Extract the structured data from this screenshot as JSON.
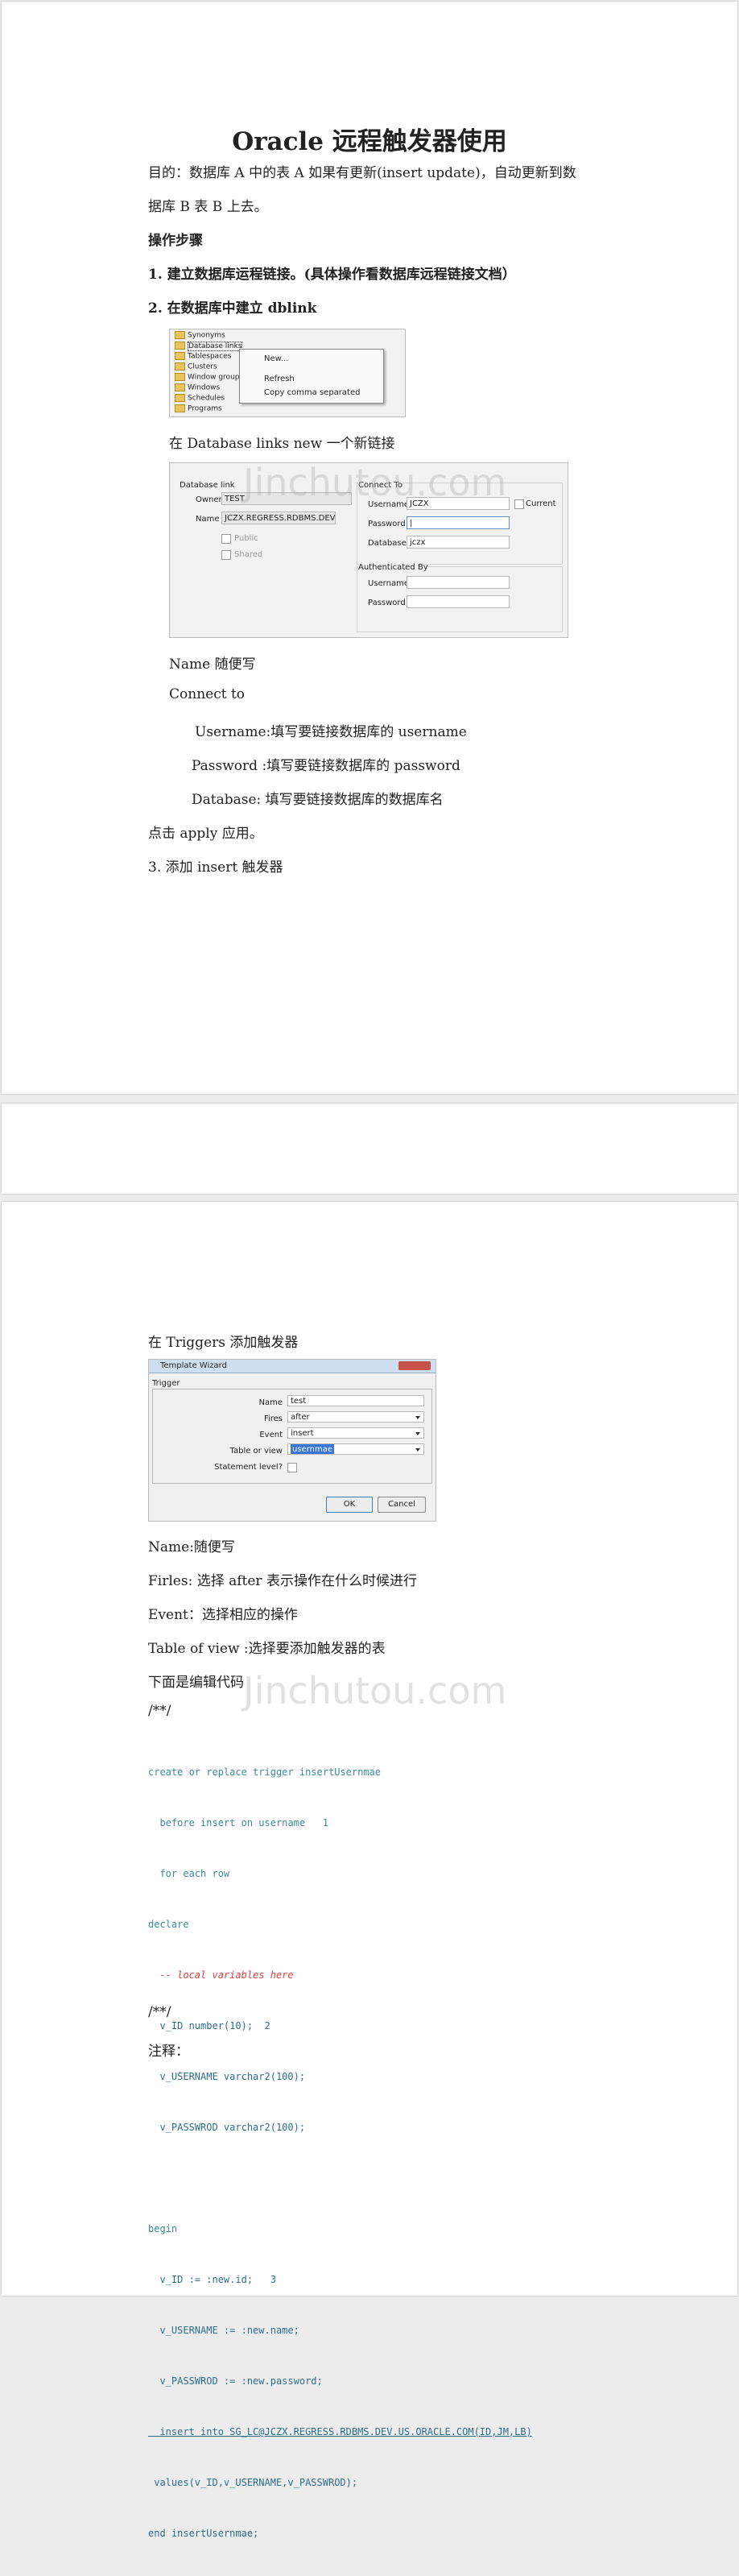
{
  "doc": {
    "title": "Oracle 远程触发器使用",
    "purpose_line1": "目的：数据库 A 中的表 A  如果有更新(insert update)，自动更新到数",
    "purpose_line2": "据库 B 表 B 上去。",
    "steps_heading": "操作步骤",
    "step1": "1.  建立数据库运程链接。(具体操作看数据库远程链接文档）",
    "step2": "2.  在数据库中建立 dblink",
    "new_link_text": "在 Database links      new  一个新链接",
    "name_note": "Name    随便写",
    "connect_to": "Connect to",
    "username_note": "Username:填写要链接数据库的 username",
    "password_note": "Password :填写要链接数据库的  password",
    "database_note": "Database:  填写要链接数据库的数据库名",
    "apply_note": "点击 apply 应用。",
    "step3": "3.  添加 insert 触发器",
    "triggers_text": "在 Triggers  添加触发器",
    "name_desc": "Name:随便写",
    "firles_desc": "Firles:  选择 after  表示操作在什么时候进行",
    "event_desc": "Event：选择相应的操作",
    "table_desc": "Table of view :选择要添加触发器的表",
    "edit_code": "下面是编辑代码",
    "code_start": "/**/",
    "code_end": "/**/",
    "notes": "注释："
  },
  "watermark": "Jinchutou.com",
  "tree": {
    "items": [
      "Synonyms",
      "Database links",
      "Tablespaces",
      "Clusters",
      "Window groups",
      "Windows",
      "Schedules",
      "Programs"
    ],
    "context_menu": [
      "New...",
      "Refresh",
      "Copy comma separated"
    ]
  },
  "dblink_form": {
    "group_label": "Database link",
    "owner_label": "Owner",
    "owner_value": "TEST",
    "name_label": "Name",
    "name_value": "JCZX.REGRESS.RDBMS.DEV.",
    "public_label": "Public",
    "shared_label": "Shared",
    "connect_to_label": "Connect To",
    "username_label": "Username",
    "username_value": "JCZX",
    "current_label": "Current",
    "password_label": "Password",
    "password_value": "|",
    "database_label": "Database",
    "database_value": "jczx",
    "auth_label": "Authenticated By",
    "auth_username_label": "Username",
    "auth_password_label": "Password"
  },
  "wizard": {
    "title": "Template Wizard",
    "group_label": "Trigger",
    "name_label": "Name",
    "name_value": "test",
    "fires_label": "Fires",
    "fires_value": "after",
    "event_label": "Event",
    "event_value": "insert",
    "table_label": "Table or view",
    "table_value": "usernmae",
    "statement_label": "Statement level?",
    "ok_label": "OK",
    "cancel_label": "Cancel"
  },
  "code": [
    "create or replace trigger insertUsernmae",
    "  before insert on username   1",
    "  for each row",
    "declare",
    "  -- local variables here",
    "  v_ID number(10);  2",
    "  v_USERNAME varchar2(100);",
    "  v_PASSWROD varchar2(100);",
    "",
    "begin",
    "  v_ID := :new.id;   3",
    "  v_USERNAME := :new.name;",
    "  v_PASSWROD := :new.password;",
    "  insert into SG_LC@JCZX.REGRESS.RDBMS.DEV.US.ORACLE.COM(ID,JM,LB)",
    " values(v_ID,v_USERNAME,v_PASSWROD);",
    "end insertUsernmae;"
  ]
}
